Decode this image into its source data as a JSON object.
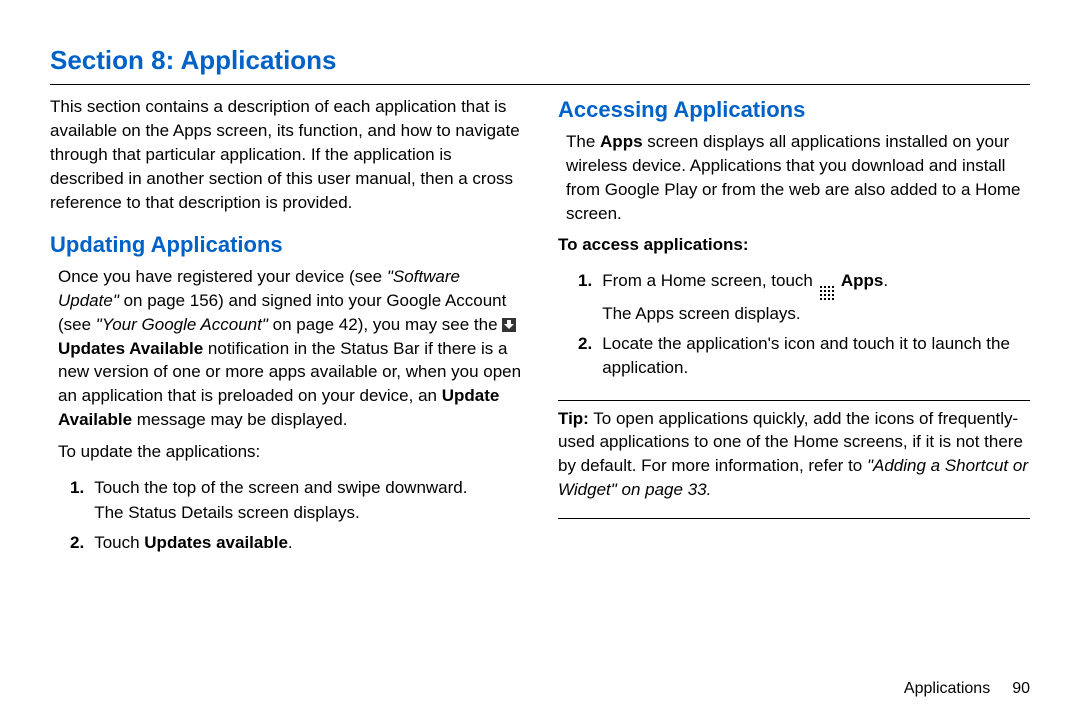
{
  "title": "Section 8: Applications",
  "intro": "This section contains a description of each application that is available on the Apps screen, its function, and how to navigate through that particular application. If the application is described in another section of this user manual, then a cross reference to that description is provided.",
  "left": {
    "h2": "Updating Applications",
    "p1a": "Once you have registered your device (see ",
    "p1b": "\"Software Update\"",
    "p1c": " on page 156) and signed into your Google Account (see ",
    "p1d": "\"Your Google Account\"",
    "p1e": " on page 42), you may see the ",
    "p1f": "Updates Available",
    "p1g": " notification in the Status Bar if there is a new version of one or more apps available or, when you open an application that is preloaded on your device, an ",
    "p1h": "Update Available",
    "p1i": " message may be displayed.",
    "lead": "To update the applications:",
    "li1a": "Touch the top of the screen and swipe downward.",
    "li1b": "The Status Details screen displays.",
    "li2a": "Touch ",
    "li2b": "Updates available",
    "li2c": "."
  },
  "right": {
    "h2": "Accessing Applications",
    "p1a": "The ",
    "p1b": "Apps",
    "p1c": " screen displays all applications installed on your wireless device. Applications that you download and install from Google Play or from the web are also added to a Home screen.",
    "subhead": "To access applications:",
    "li1a": "From a Home screen, touch ",
    "li1b": "Apps",
    "li1c": ".",
    "li1d": "The Apps screen displays.",
    "li2": "Locate the application's icon and touch it to launch the application.",
    "tip_label": "Tip:",
    "tip_a": " To open applications quickly, add the icons of frequently-used applications to one of the Home screens, if it is not there by default. For more information, refer to ",
    "tip_b": "\"Adding a Shortcut or Widget\"",
    "tip_c": " on page 33."
  },
  "footer": {
    "section": "Applications",
    "page": "90"
  }
}
